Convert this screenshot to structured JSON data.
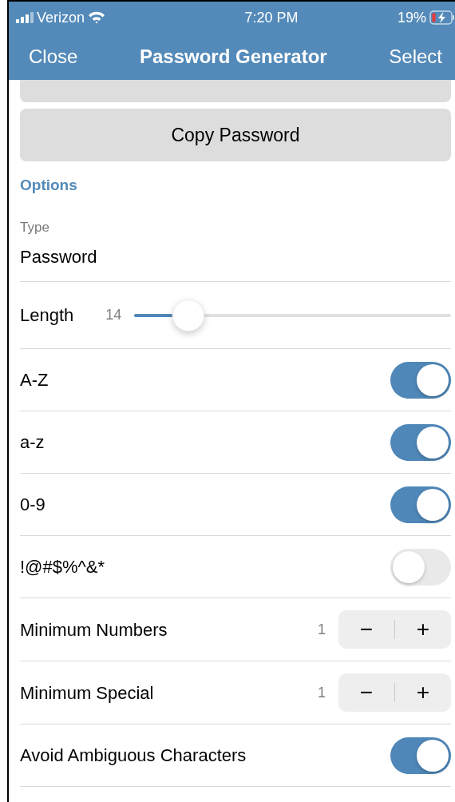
{
  "status_bar": {
    "carrier": "Verizon",
    "time": "7:20 PM",
    "battery": "19%"
  },
  "nav": {
    "left": "Close",
    "title": "Password Generator",
    "right": "Select"
  },
  "copy_button": "Copy Password",
  "section": "Options",
  "type": {
    "label": "Type",
    "value": "Password"
  },
  "rows": [
    {
      "kind": "slider",
      "label": "Length",
      "reading": "14",
      "level": 0.12
    },
    {
      "kind": "toggle",
      "label": "A-Z",
      "on": true
    },
    {
      "kind": "toggle",
      "label": "a-z",
      "on": true
    },
    {
      "kind": "toggle",
      "label": "0-9",
      "on": true
    },
    {
      "kind": "toggle",
      "label": "!@#$%^&*",
      "on": false
    },
    {
      "kind": "stepper",
      "label": "Minimum Numbers",
      "reading": "1",
      "minus": "−",
      "plus": "+"
    },
    {
      "kind": "stepper",
      "label": "Minimum Special",
      "reading": "1",
      "minus": "−",
      "plus": "+"
    },
    {
      "kind": "toggle",
      "label": "Avoid Ambiguous Characters",
      "on": true
    }
  ]
}
